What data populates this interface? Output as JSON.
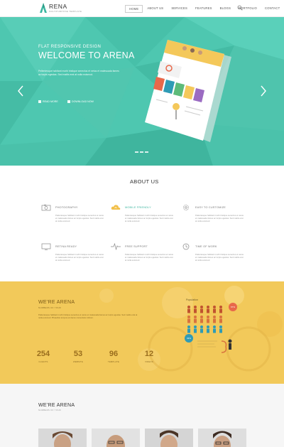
{
  "nav": {
    "logo_name": "RENA",
    "logo_tagline": "MULTIPURPOSE TEMPLATE",
    "items": [
      {
        "label": "HOME",
        "active": true
      },
      {
        "label": "ABOUT US",
        "active": false
      },
      {
        "label": "SERVICES",
        "active": false
      },
      {
        "label": "FEATURES",
        "active": false
      },
      {
        "label": "BLOGS",
        "active": false
      },
      {
        "label": "PORTFOLIO",
        "active": false
      },
      {
        "label": "CONTACT",
        "active": false
      }
    ],
    "search_icon": "search-icon"
  },
  "hero": {
    "subtitle": "FLAT RESPONSIVE DESIGN",
    "title": "WELCOME TO ARENA",
    "text": "Pellentesque habitant morbi tristique senectus et netus et malesuada fames ac turpis egestas. Sed mattis erat at nulla euismod.",
    "link_more": "READ MORE",
    "link_download": "DOWNLOAD NOW",
    "slide_count": 3,
    "bg_color": "#4ec7b0"
  },
  "about": {
    "title": "ABOUT US",
    "text": "Pellentesque habitant morbi tristique senectus et netus et malesuada fames ac turpis egestas. Sed mattis erat at nulla euismod.",
    "features": [
      {
        "title": "PHOTOGRAPHY",
        "icon": "camera-icon",
        "accent": false
      },
      {
        "title": "MOBILE FRIENDLY",
        "icon": "cloud-upload-icon",
        "accent": true
      },
      {
        "title": "EASY TO CUSTOMIZE",
        "icon": "settings-icon",
        "accent": false
      },
      {
        "title": "RETINA READY",
        "icon": "monitor-icon",
        "accent": false
      },
      {
        "title": "FREE SUPPORT",
        "icon": "heartbeat-icon",
        "accent": false
      },
      {
        "title": "TIME OF WORK",
        "icon": "clock-icon",
        "accent": false
      }
    ]
  },
  "stats": {
    "title": "WE'RE ARENA",
    "subtitle": "NUMBERS OF YOUR",
    "text": "Pellentesque habitant morbi tristique senectus et netus et malesuada fames ac turpis egestas. Sed mattis erat at nulla euismod. Phasellus tempus est lacus consectetur dictum.",
    "items": [
      {
        "value": "254",
        "label": "CLIENTS"
      },
      {
        "value": "53",
        "label": "WEBSITE"
      },
      {
        "value": "96",
        "label": "TEMPLATE"
      },
      {
        "value": "12",
        "label": "VIDEOS"
      }
    ],
    "infographic_label": "Population",
    "infographic_pct_a": "67%",
    "infographic_pct_b": "33%",
    "bg_color": "#f2c95a"
  },
  "team": {
    "title": "WE'RE ARENA",
    "subtitle": "NUMBERS OF YOUR"
  }
}
